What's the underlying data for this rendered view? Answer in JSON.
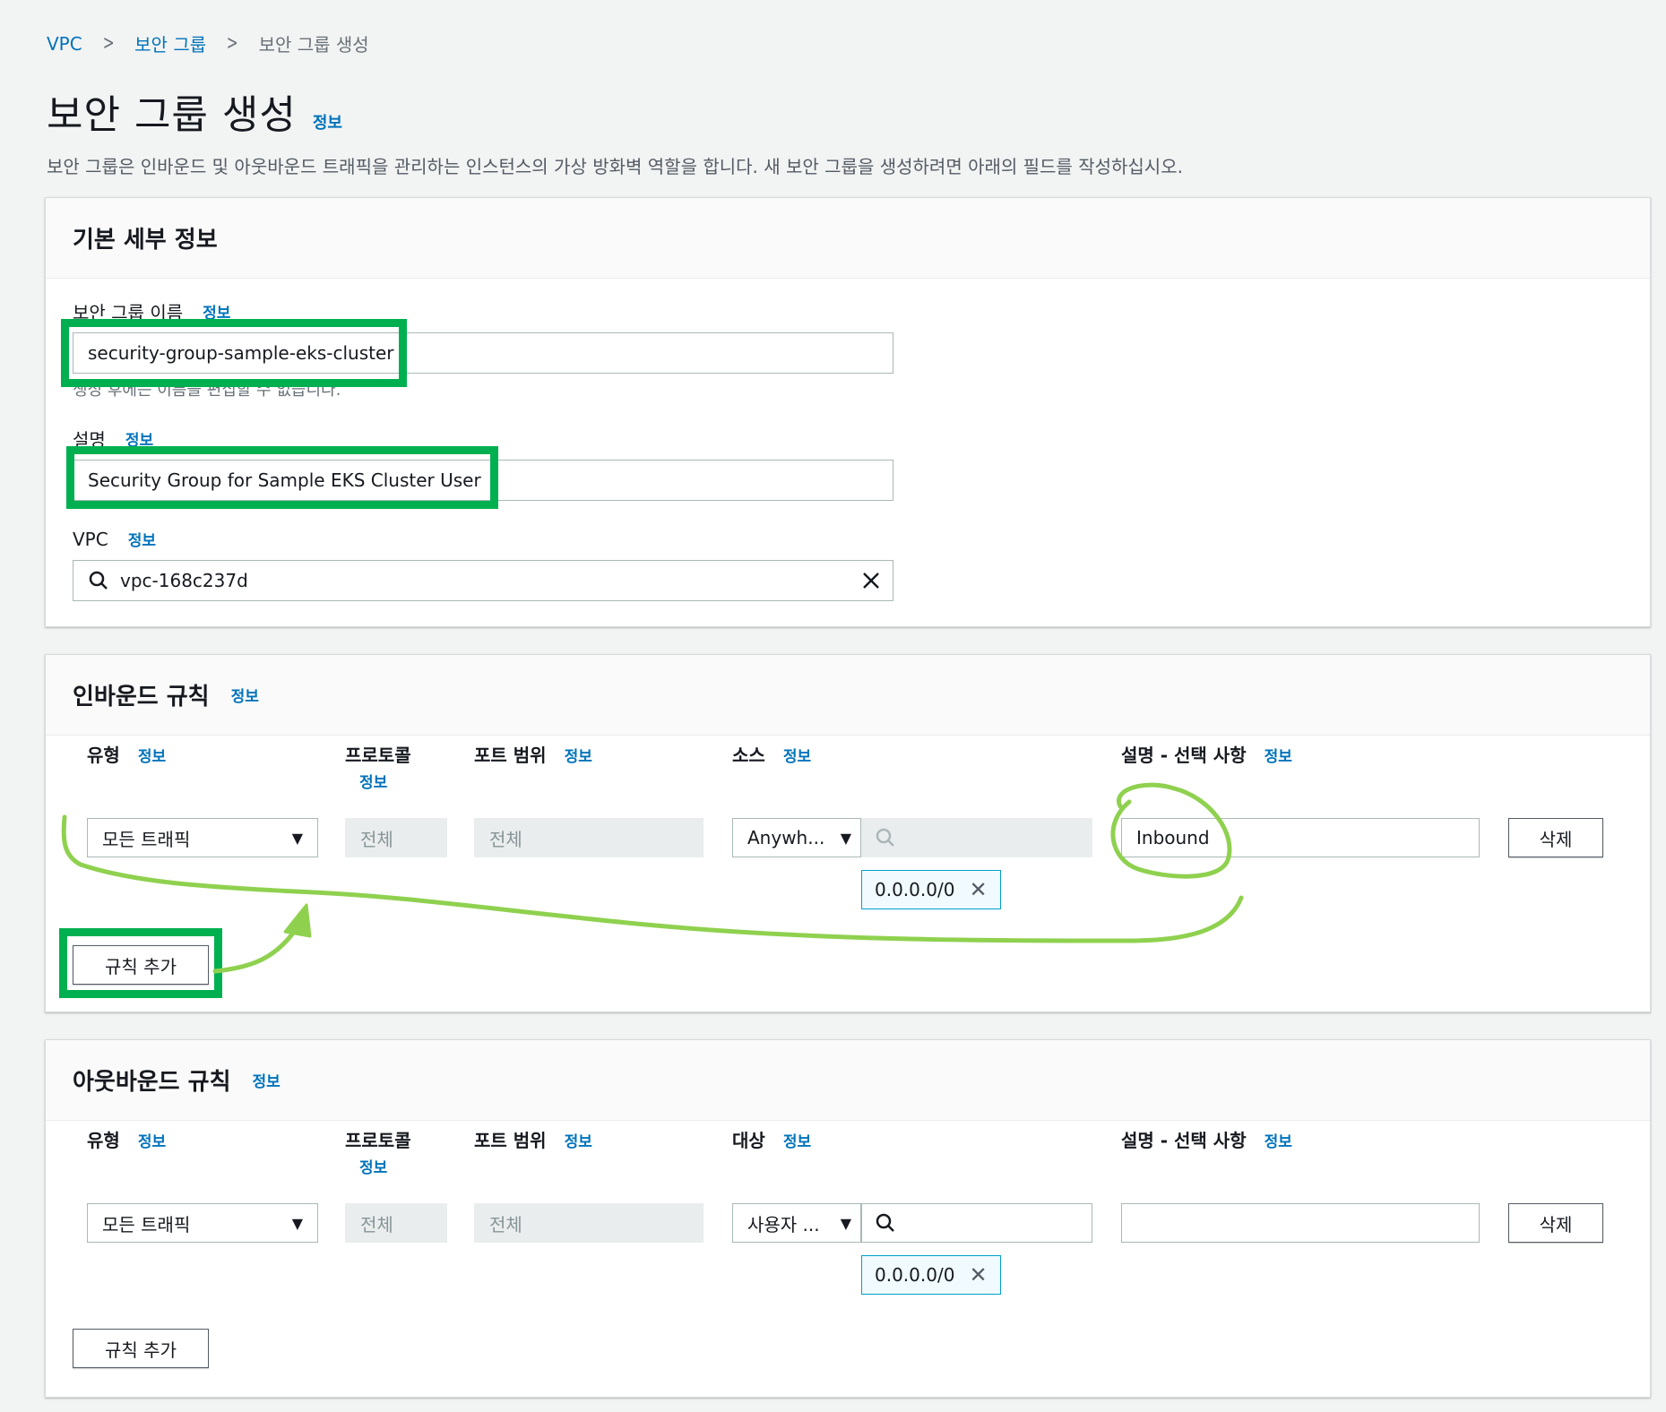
{
  "breadcrumb": {
    "items": [
      "VPC",
      "보안 그룹",
      "보안 그룹 생성"
    ]
  },
  "page": {
    "title": "보안 그룹 생성",
    "info": "정보",
    "description": "보안 그룹은 인바운드 및 아웃바운드 트래픽을 관리하는 인스턴스의 가상 방화벽 역할을 합니다. 새 보안 그룹을 생성하려면 아래의 필드를 작성하십시오."
  },
  "basic": {
    "title": "기본 세부 정보",
    "name_label": "보안 그룹 이름",
    "name_value": "security-group-sample-eks-cluster",
    "name_hint": "생성 후에는 이름을 편집할 수 없습니다.",
    "desc_label": "설명",
    "desc_value": "Security Group for Sample EKS Cluster User",
    "vpc_label": "VPC",
    "vpc_value": "vpc-168c237d"
  },
  "inbound": {
    "title": "인바운드 규칙",
    "col_type": "유형",
    "col_protocol": "프로토콜",
    "col_port": "포트 범위",
    "col_source": "소스",
    "col_desc": "설명 - 선택 사항",
    "type_value": "모든 트래픽",
    "protocol_value": "전체",
    "port_value": "전체",
    "source_value": "Anywh...",
    "cidr": "0.0.0.0/0",
    "desc_value": "Inbound",
    "delete": "삭제",
    "add_rule": "규칙 추가"
  },
  "outbound": {
    "title": "아웃바운드 규칙",
    "col_type": "유형",
    "col_protocol": "프로토콜",
    "col_port": "포트 범위",
    "col_dest": "대상",
    "col_desc": "설명 - 선택 사항",
    "type_value": "모든 트래픽",
    "protocol_value": "전체",
    "port_value": "전체",
    "dest_value": "사용자 ...",
    "cidr": "0.0.0.0/0",
    "desc_value": "",
    "delete": "삭제",
    "add_rule": "규칙 추가"
  },
  "colors": {
    "link": "#0073bb",
    "highlight_box": "#00b050",
    "annotation_stroke": "#8fd14f"
  },
  "icons": {
    "breadcrumb_sep": "chevron-right-icon",
    "search": "search-icon",
    "clear": "close-icon",
    "caret": "caret-down-icon",
    "token_remove": "close-icon"
  }
}
